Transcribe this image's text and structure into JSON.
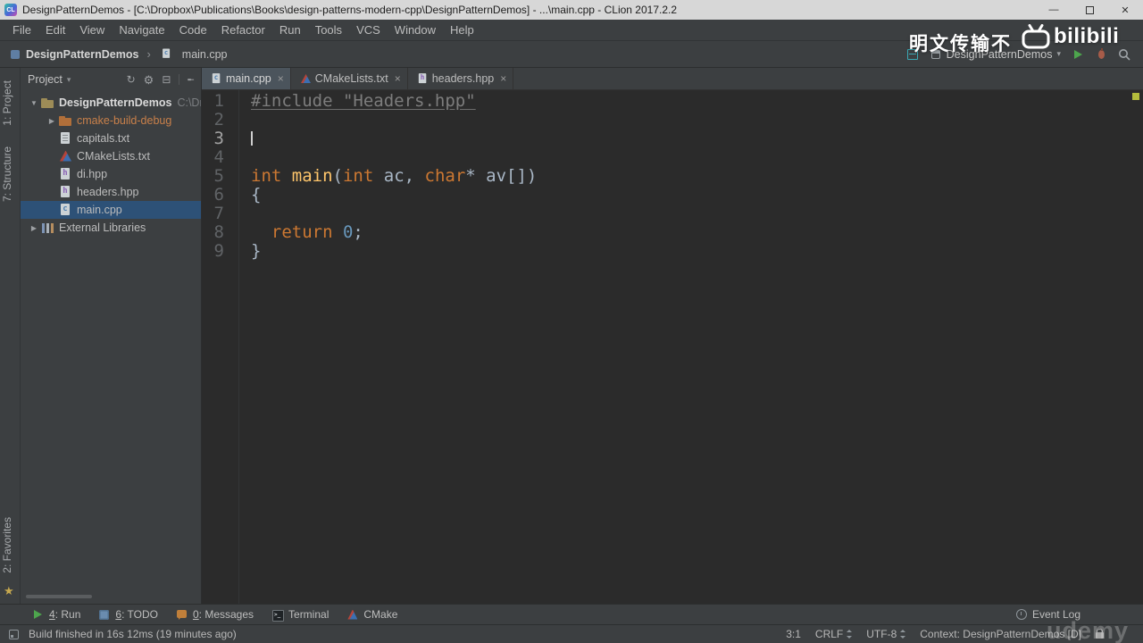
{
  "colors": {
    "keyword": "#cc7832",
    "function_name": "#ffc66b",
    "number_literal": "#6897bb",
    "editor_text": "#a9b7c6",
    "unused_symbol": "#7d7d7d",
    "tree_selection": "#2d5177",
    "excluded_folder_text": "#c9804a",
    "run_green": "#4da54d",
    "editor_background": "#2b2b2b",
    "panel_background": "#3c3f41"
  },
  "window": {
    "title": "DesignPatternDemos - [C:\\Dropbox\\Publications\\Books\\design-patterns-modern-cpp\\DesignPatternDemos] - ...\\main.cpp - CLion 2017.2.2",
    "app_badge": "CL",
    "minimize": "—",
    "close": "✕"
  },
  "menu": {
    "items": [
      "File",
      "Edit",
      "View",
      "Navigate",
      "Code",
      "Refactor",
      "Run",
      "Tools",
      "VCS",
      "Window",
      "Help"
    ]
  },
  "navbar": {
    "project_crumb": "DesignPatternDemos",
    "separator": "›",
    "file_crumb": "main.cpp",
    "run_config": "DesignPatternDemos",
    "run_config_caret": "▾"
  },
  "watermarks": {
    "chinese_text": "明文传输不",
    "logo_text": "bilibili",
    "udemy_text": "udemy"
  },
  "stripe": {
    "project": "1: Project",
    "structure": "7: Structure",
    "favorites": "2: Favorites",
    "favorites_star": "★"
  },
  "project_panel": {
    "title": "Project",
    "title_caret": "▾",
    "items": [
      {
        "label": "DesignPatternDemos",
        "hint": "C:\\Drop",
        "icon": "folder",
        "arrow": "open",
        "indent": 0,
        "bold": true
      },
      {
        "label": "cmake-build-debug",
        "icon": "folder-excluded",
        "arrow": "closed",
        "indent": 1,
        "excluded": true
      },
      {
        "label": "capitals.txt",
        "icon": "file-text",
        "indent": 1
      },
      {
        "label": "CMakeLists.txt",
        "icon": "file-cmake",
        "indent": 1
      },
      {
        "label": "di.hpp",
        "icon": "file-header",
        "indent": 1
      },
      {
        "label": "headers.hpp",
        "icon": "file-header",
        "indent": 1
      },
      {
        "label": "main.cpp",
        "icon": "file-cpp",
        "indent": 1,
        "selected": true
      },
      {
        "label": "External Libraries",
        "icon": "libs",
        "arrow": "closed",
        "indent": 0
      }
    ]
  },
  "editor": {
    "tabs": [
      {
        "label": "main.cpp",
        "icon": "file-cpp",
        "active": true
      },
      {
        "label": "CMakeLists.txt",
        "icon": "file-cmake",
        "active": false
      },
      {
        "label": "headers.hpp",
        "icon": "file-header",
        "active": false
      }
    ],
    "close_glyph": "×",
    "lines": [
      {
        "num": "1",
        "tokens": [
          {
            "t": "#include \"Headers.hpp\"",
            "c": "unused"
          }
        ]
      },
      {
        "num": "2",
        "tokens": []
      },
      {
        "num": "3",
        "tokens": [],
        "caret": true,
        "current": true
      },
      {
        "num": "4",
        "tokens": []
      },
      {
        "num": "5",
        "tokens": [
          {
            "t": "int ",
            "c": "kw"
          },
          {
            "t": "main",
            "c": "fn"
          },
          {
            "t": "(",
            "c": "pl"
          },
          {
            "t": "int",
            "c": "kw"
          },
          {
            "t": " ac, ",
            "c": "pl"
          },
          {
            "t": "char",
            "c": "kw"
          },
          {
            "t": "* av[])",
            "c": "pl"
          }
        ]
      },
      {
        "num": "6",
        "tokens": [
          {
            "t": "{",
            "c": "pl"
          }
        ]
      },
      {
        "num": "7",
        "tokens": []
      },
      {
        "num": "8",
        "tokens": [
          {
            "t": "  ",
            "c": "pl"
          },
          {
            "t": "return ",
            "c": "kw"
          },
          {
            "t": "0",
            "c": "num"
          },
          {
            "t": ";",
            "c": "pl"
          }
        ]
      },
      {
        "num": "9",
        "tokens": [
          {
            "t": "}",
            "c": "pl"
          }
        ]
      }
    ]
  },
  "toolwindow_bar": {
    "items": [
      {
        "label": "4: Run",
        "icon": "run",
        "mnemonic": true
      },
      {
        "label": "6: TODO",
        "icon": "todo",
        "mnemonic": true
      },
      {
        "label": "0: Messages",
        "icon": "messages",
        "mnemonic": true
      },
      {
        "label": "Terminal",
        "icon": "terminal",
        "mnemonic": false
      },
      {
        "label": "CMake",
        "icon": "cmake",
        "mnemonic": false
      }
    ],
    "event_log": "Event Log"
  },
  "status_bar": {
    "message": "Build finished in 16s 12ms (19 minutes ago)",
    "caret_position": "3:1",
    "line_separator": "CRLF",
    "encoding": "UTF-8",
    "context": "Context: DesignPatternDemos [D]"
  }
}
